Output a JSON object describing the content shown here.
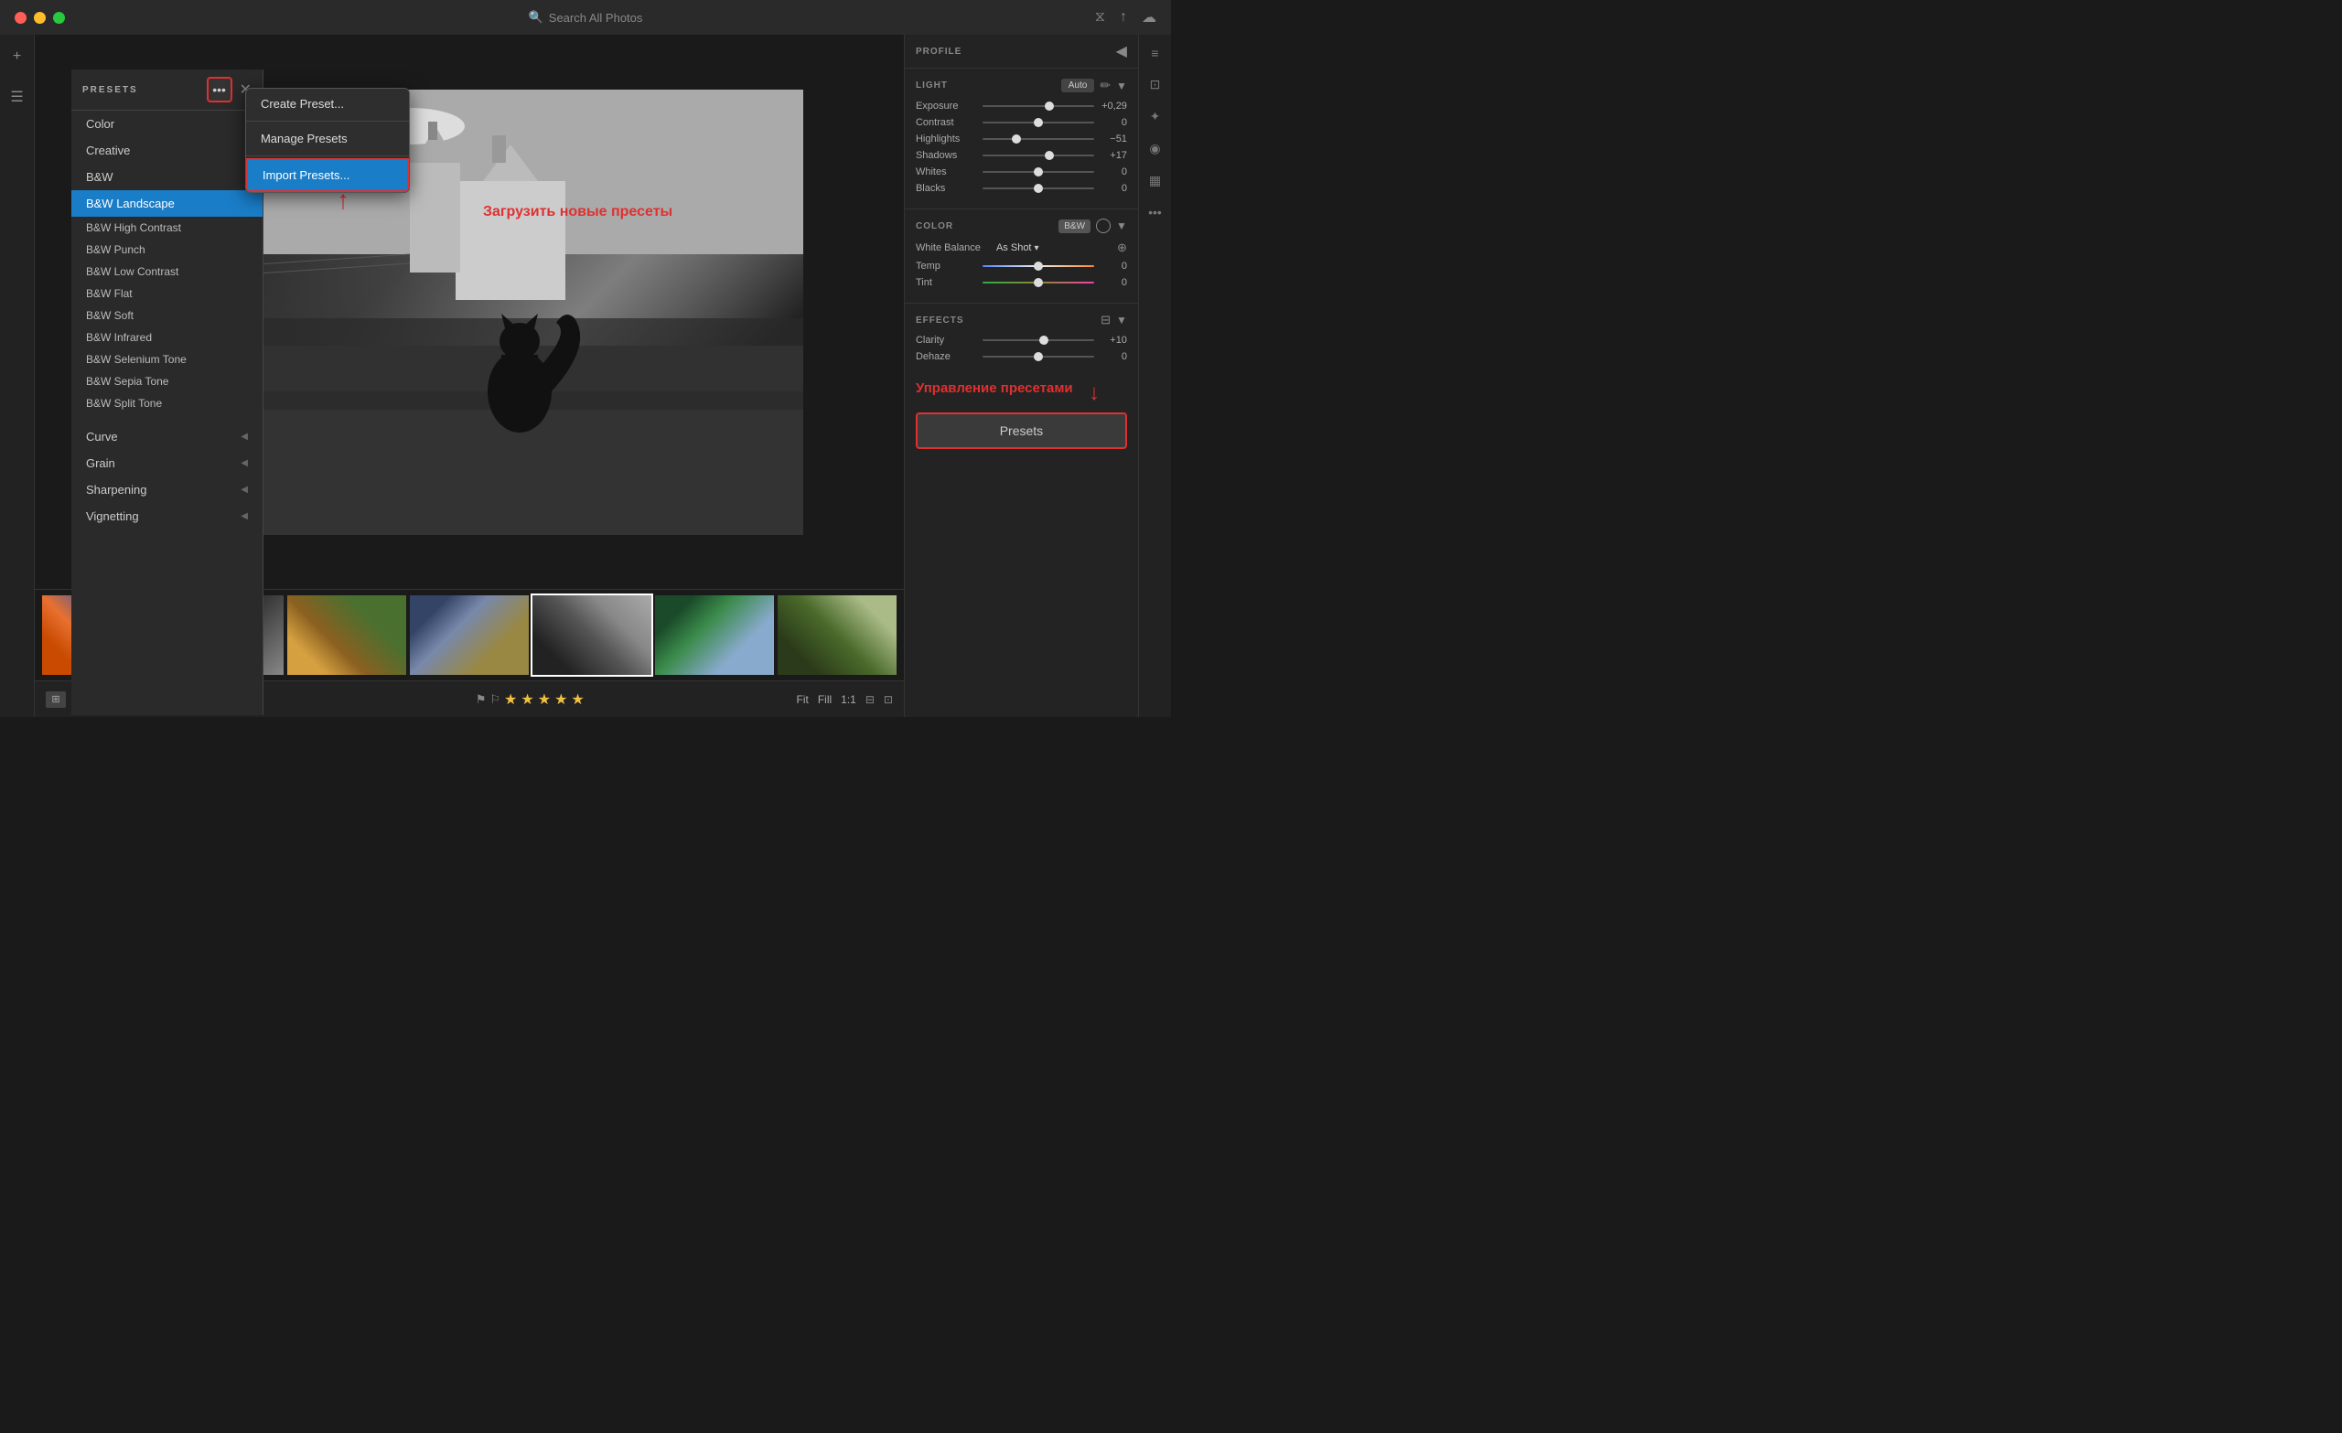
{
  "titlebar": {
    "search_placeholder": "Search All Photos"
  },
  "presets_panel": {
    "title": "PRESETS",
    "items": [
      {
        "label": "Color",
        "active": false
      },
      {
        "label": "Creative",
        "active": false
      },
      {
        "label": "B&W",
        "active": false
      },
      {
        "label": "B&W Landscape",
        "active": true
      },
      {
        "label": "B&W High Contrast",
        "active": false
      },
      {
        "label": "B&W Punch",
        "active": false
      },
      {
        "label": "B&W Low Contrast",
        "active": false
      },
      {
        "label": "B&W Flat",
        "active": false
      },
      {
        "label": "B&W Soft",
        "active": false
      },
      {
        "label": "B&W Infrared",
        "active": false
      },
      {
        "label": "B&W Selenium Tone",
        "active": false
      },
      {
        "label": "B&W Sepia Tone",
        "active": false
      },
      {
        "label": "B&W Split Tone",
        "active": false
      }
    ],
    "categories": [
      {
        "label": "Curve"
      },
      {
        "label": "Grain"
      },
      {
        "label": "Sharpening"
      },
      {
        "label": "Vignetting"
      }
    ]
  },
  "dropdown": {
    "items": [
      {
        "label": "Create Preset...",
        "highlighted": false
      },
      {
        "label": "Manage Presets",
        "highlighted": false
      },
      {
        "label": "Import Presets...",
        "highlighted": true
      }
    ]
  },
  "profile_panel": {
    "title": "PROFILE"
  },
  "light_panel": {
    "title": "IGHT",
    "auto_label": "Auto",
    "sliders": [
      {
        "label": "Exposure",
        "value": "+0,29",
        "percent": 60
      },
      {
        "label": "Contrast",
        "value": "0",
        "percent": 50
      },
      {
        "label": "Highlights",
        "value": "−51",
        "percent": 30
      },
      {
        "label": "Shadows",
        "value": "+17",
        "percent": 60
      },
      {
        "label": "Whites",
        "value": "0",
        "percent": 50
      },
      {
        "label": "Blacks",
        "value": "0",
        "percent": 50
      }
    ]
  },
  "color_panel": {
    "title": "COLOR",
    "bw_label": "B&W",
    "white_balance_label": "White Balance",
    "white_balance_value": "As Shot",
    "sliders": [
      {
        "label": "Temp",
        "value": "0",
        "percent": 50
      },
      {
        "label": "Tint",
        "value": "0",
        "percent": 50
      }
    ]
  },
  "effects_panel": {
    "title": "EFFECTS",
    "sliders": [
      {
        "label": "Clarity",
        "value": "+10",
        "percent": 55
      },
      {
        "label": "Dehaze",
        "value": "0",
        "percent": 50
      }
    ]
  },
  "presets_button": {
    "label": "Presets"
  },
  "annotations": {
    "load_presets": "Загрузить новые пресеты",
    "manage_presets": "Управление пресетами"
  },
  "filmstrip": {
    "thumbs": [
      1,
      2,
      3,
      4,
      5,
      6,
      7
    ]
  },
  "bottom_toolbar": {
    "fit_label": "Fit",
    "fill_label": "Fill",
    "one_to_one": "1:1"
  },
  "stars": [
    "★",
    "★",
    "★",
    "★",
    "★"
  ]
}
